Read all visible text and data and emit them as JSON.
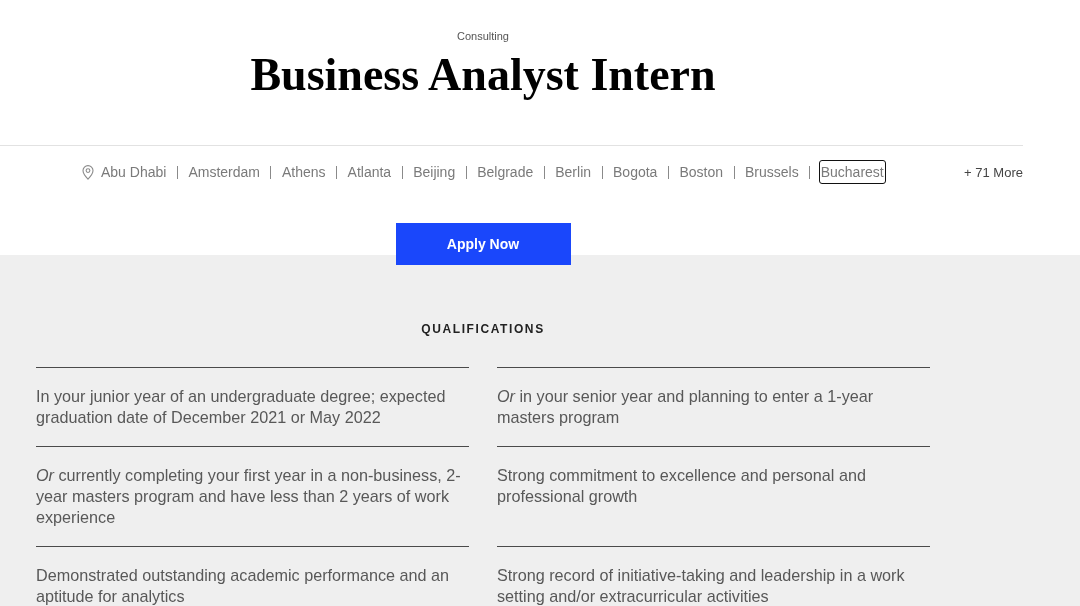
{
  "header": {
    "category": "Consulting",
    "title": "Business Analyst Intern"
  },
  "locations": {
    "items": [
      {
        "name": "Abu Dhabi",
        "focused": false
      },
      {
        "name": "Amsterdam",
        "focused": false
      },
      {
        "name": "Athens",
        "focused": false
      },
      {
        "name": "Atlanta",
        "focused": false
      },
      {
        "name": "Beijing",
        "focused": false
      },
      {
        "name": "Belgrade",
        "focused": false
      },
      {
        "name": "Berlin",
        "focused": false
      },
      {
        "name": "Bogota",
        "focused": false
      },
      {
        "name": "Boston",
        "focused": false
      },
      {
        "name": "Brussels",
        "focused": false
      },
      {
        "name": "Bucharest",
        "focused": true
      }
    ],
    "more": "+ 71 More"
  },
  "apply_button": {
    "label": "Apply Now"
  },
  "qualifications": {
    "heading": "QUALIFICATIONS",
    "items": [
      "In your junior year of an undergraduate degree; expected graduation date of December 2021 or May 2022",
      "*Or* in your senior year and planning to enter a 1-year masters program",
      "*Or* currently completing your first year in a non-business, 2-year masters program and have less than 2 years of work experience",
      "Strong commitment to excellence and personal and professional growth",
      "Demonstrated outstanding academic performance and an aptitude for analytics",
      "Strong record of initiative-taking and leadership in a work setting and/or extracurricular activities"
    ]
  }
}
